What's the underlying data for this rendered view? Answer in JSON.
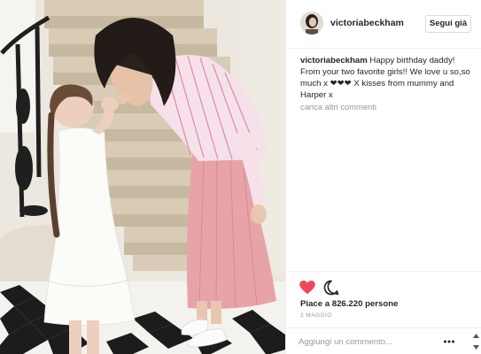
{
  "post": {
    "username": "victoriabeckham",
    "follow_label": "Segui già",
    "caption": {
      "user": "victoriabeckham",
      "text": "Happy birthday daddy! From your two favorite girls!! We love u so,so much x ❤❤❤ X kisses from mummy and Harper x"
    },
    "load_more": "carica altri commenti",
    "likes": "Piace a 826.220 persone",
    "date": "2 MAGGIO",
    "comment_placeholder": "Aggiungi un commento...",
    "icons": {
      "like": "heart-icon",
      "comment": "comment-icon",
      "options": "more-options-icon",
      "scroll": "scroll-arrows-icon"
    },
    "colors": {
      "like_red": "#ed4956",
      "follow_border": "#dbdbdb",
      "muted": "#999999"
    }
  }
}
